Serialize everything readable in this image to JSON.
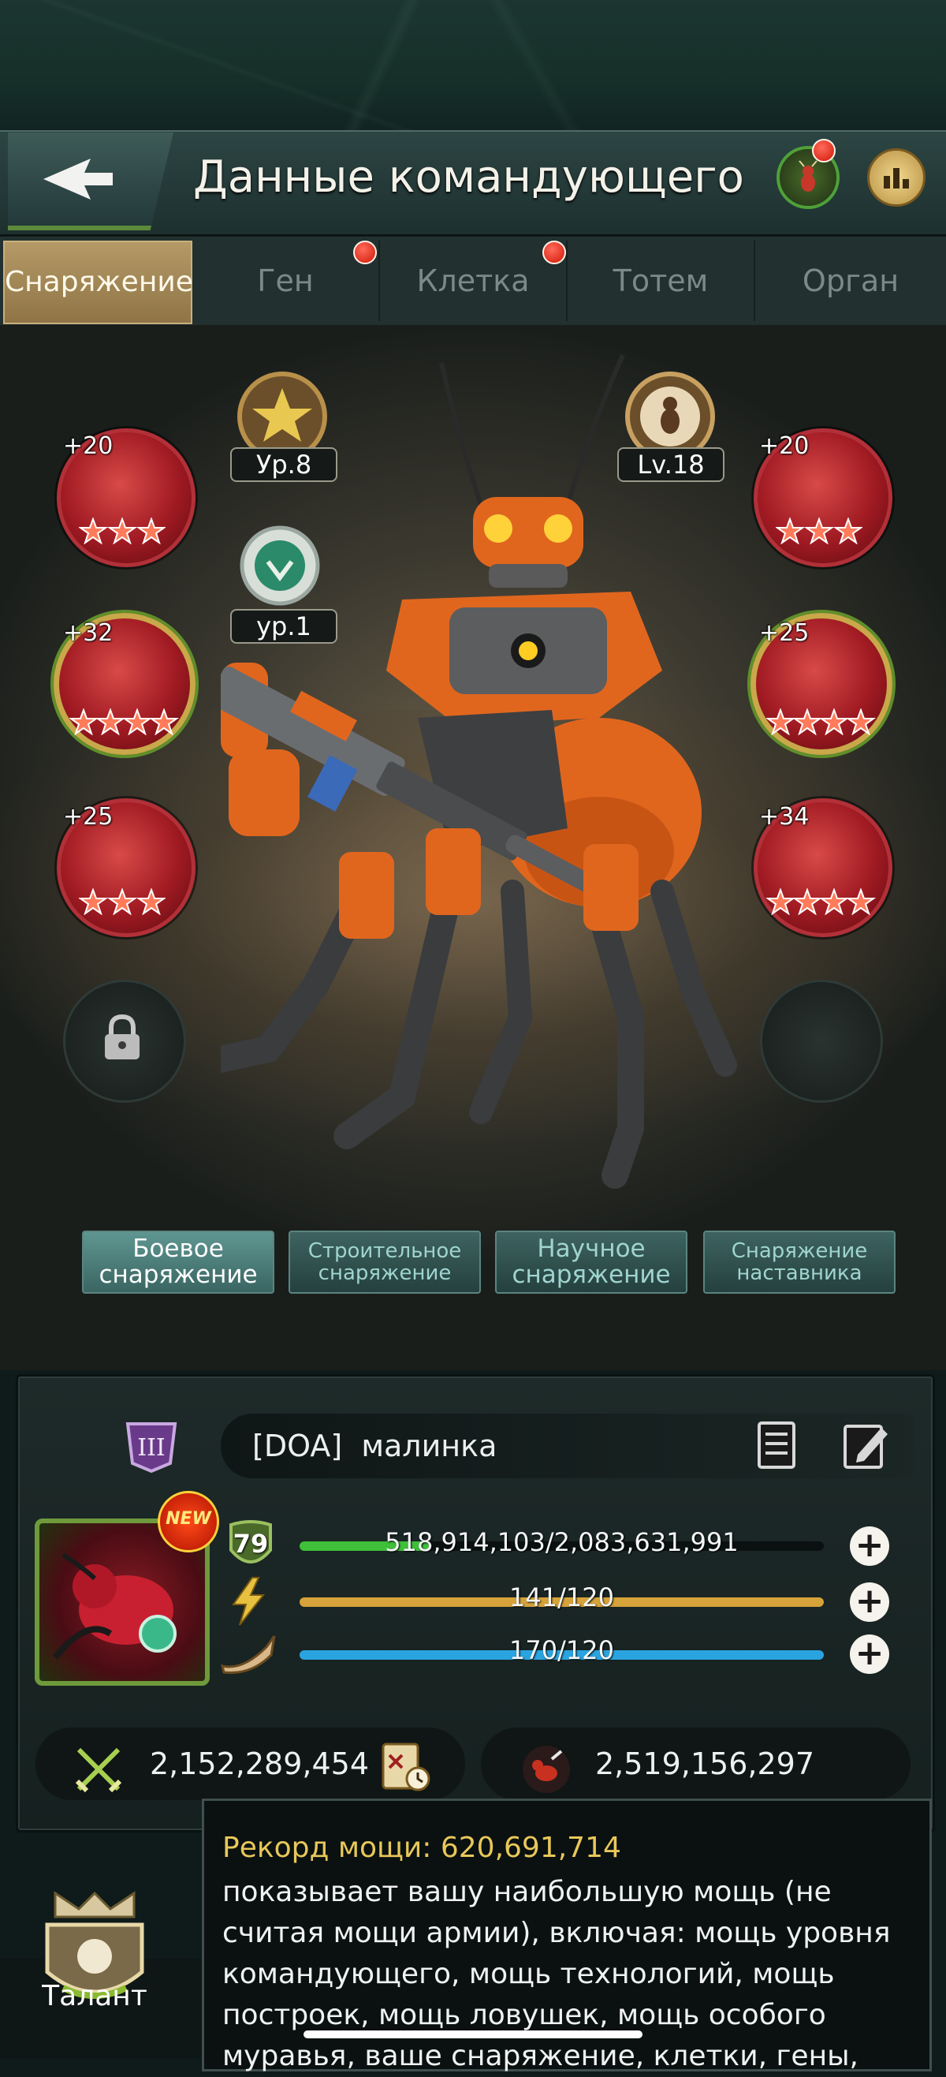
{
  "header": {
    "title": "Данные командующего",
    "back_icon": "back-arrow-icon",
    "ant_button_icon": "ant-icon",
    "ranking_icon": "bar-chart-icon"
  },
  "tabs": [
    {
      "label": "Снаряжение",
      "active": true,
      "dot": false
    },
    {
      "label": "Ген",
      "active": false,
      "dot": true
    },
    {
      "label": "Клетка",
      "active": false,
      "dot": true
    },
    {
      "label": "Тотем",
      "active": false,
      "dot": false
    },
    {
      "label": "Орган",
      "active": false,
      "dot": false
    }
  ],
  "medals": {
    "left_level": "Ур.8",
    "left_sub_level": "ур.1",
    "right_level": "Lv.18"
  },
  "equipment_slots": {
    "left": [
      {
        "bonus": "+20",
        "stars": 3
      },
      {
        "bonus": "+32",
        "stars": 4
      },
      {
        "bonus": "+25",
        "stars": 3
      }
    ],
    "right": [
      {
        "bonus": "+20",
        "stars": 3
      },
      {
        "bonus": "+25",
        "stars": 4
      },
      {
        "bonus": "+34",
        "stars": 4
      }
    ]
  },
  "categories": [
    {
      "label_line1": "Боевое",
      "label_line2": "снаряжение",
      "active": true
    },
    {
      "label_line1": "Строительное",
      "label_line2": "снаряжение",
      "active": false
    },
    {
      "label_line1": "Научное",
      "label_line2": "снаряжение",
      "active": false
    },
    {
      "label_line1": "Снаряжение",
      "label_line2": "наставника",
      "active": false
    }
  ],
  "profile": {
    "alliance_tag": "[DOA]",
    "name": "малинка",
    "level": "79",
    "exp": "518,914,103/2,083,631,991",
    "exp_fraction": 0.249,
    "energy": "141/120",
    "energy_fraction": 1.0,
    "stamina": "170/120",
    "stamina_fraction": 1.0,
    "new_badge": "NEW",
    "power": "2,152,289,454",
    "kills": "2,519,156,297",
    "colors": {
      "exp": "#3fbf3a",
      "energy": "#d6a23a",
      "stamina": "#2aa4e0"
    }
  },
  "tooltip": {
    "title": "Рекорд мощи: 620,691,714",
    "body": "показывает вашу наибольшую мощь (не считая мощи армии), включая: мощь уровня командующего, мощь технологий, мощь построек, мощь ловушек, мощь особого муравья, ваше снаряжение, клетки, гены,"
  },
  "bottom": {
    "talent_label": "Талант"
  }
}
